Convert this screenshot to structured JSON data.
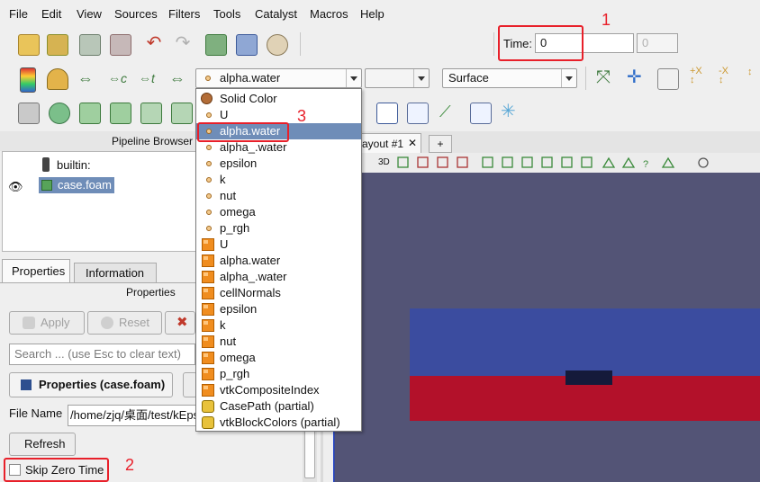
{
  "menubar": {
    "items": [
      "File",
      "Edit",
      "View",
      "Sources",
      "Filters",
      "Tools",
      "Catalyst",
      "Macros",
      "Help"
    ]
  },
  "time": {
    "label": "Time:",
    "value": "0",
    "index": "0"
  },
  "toolbar2": {
    "array_combo": "alpha.water",
    "component_combo": "",
    "representation_combo": "Surface"
  },
  "dropdown": {
    "items": [
      {
        "label": "Solid Color",
        "icon": "solid-color"
      },
      {
        "label": "U",
        "icon": "point"
      },
      {
        "label": "alpha.water",
        "icon": "point",
        "selected": true
      },
      {
        "label": "alpha_.water",
        "icon": "point"
      },
      {
        "label": "epsilon",
        "icon": "point"
      },
      {
        "label": "k",
        "icon": "point"
      },
      {
        "label": "nut",
        "icon": "point"
      },
      {
        "label": "omega",
        "icon": "point"
      },
      {
        "label": "p_rgh",
        "icon": "point"
      },
      {
        "label": "U",
        "icon": "cell"
      },
      {
        "label": "alpha.water",
        "icon": "cell"
      },
      {
        "label": "alpha_.water",
        "icon": "cell"
      },
      {
        "label": "cellNormals",
        "icon": "cell"
      },
      {
        "label": "epsilon",
        "icon": "cell"
      },
      {
        "label": "k",
        "icon": "cell"
      },
      {
        "label": "nut",
        "icon": "cell"
      },
      {
        "label": "omega",
        "icon": "cell"
      },
      {
        "label": "p_rgh",
        "icon": "cell"
      },
      {
        "label": "vtkCompositeIndex",
        "icon": "cell"
      },
      {
        "label": "CasePath (partial)",
        "icon": "field-partial"
      },
      {
        "label": "vtkBlockColors (partial)",
        "icon": "field-partial"
      }
    ]
  },
  "pipeline": {
    "title": "Pipeline Browser",
    "items": [
      "builtin:",
      "case.foam"
    ]
  },
  "tabs": {
    "properties": "Properties",
    "information": "Information"
  },
  "properties": {
    "header": "Properties",
    "apply": "Apply",
    "reset": "Reset",
    "search_placeholder": "Search ... (use Esc to clear text)",
    "section": "Properties (case.foam)",
    "file_name_label": "File Name",
    "file_name_value": "/home/zjq/桌面/test/kEps",
    "refresh": "Refresh",
    "skip_zero_time": "Skip Zero Time"
  },
  "view": {
    "layout_tab": "ayout #1",
    "close": "✕",
    "add_tab": "+",
    "mode_3d": "3D",
    "help_glyph": "?"
  },
  "annotations": [
    "1",
    "2",
    "3"
  ],
  "colors": {
    "accent_red": "#e8202a",
    "selection": "#6f8db8",
    "viewport_bg": "#535476",
    "water_blue": "#3b4c9f",
    "air_red": "#b3112a"
  }
}
